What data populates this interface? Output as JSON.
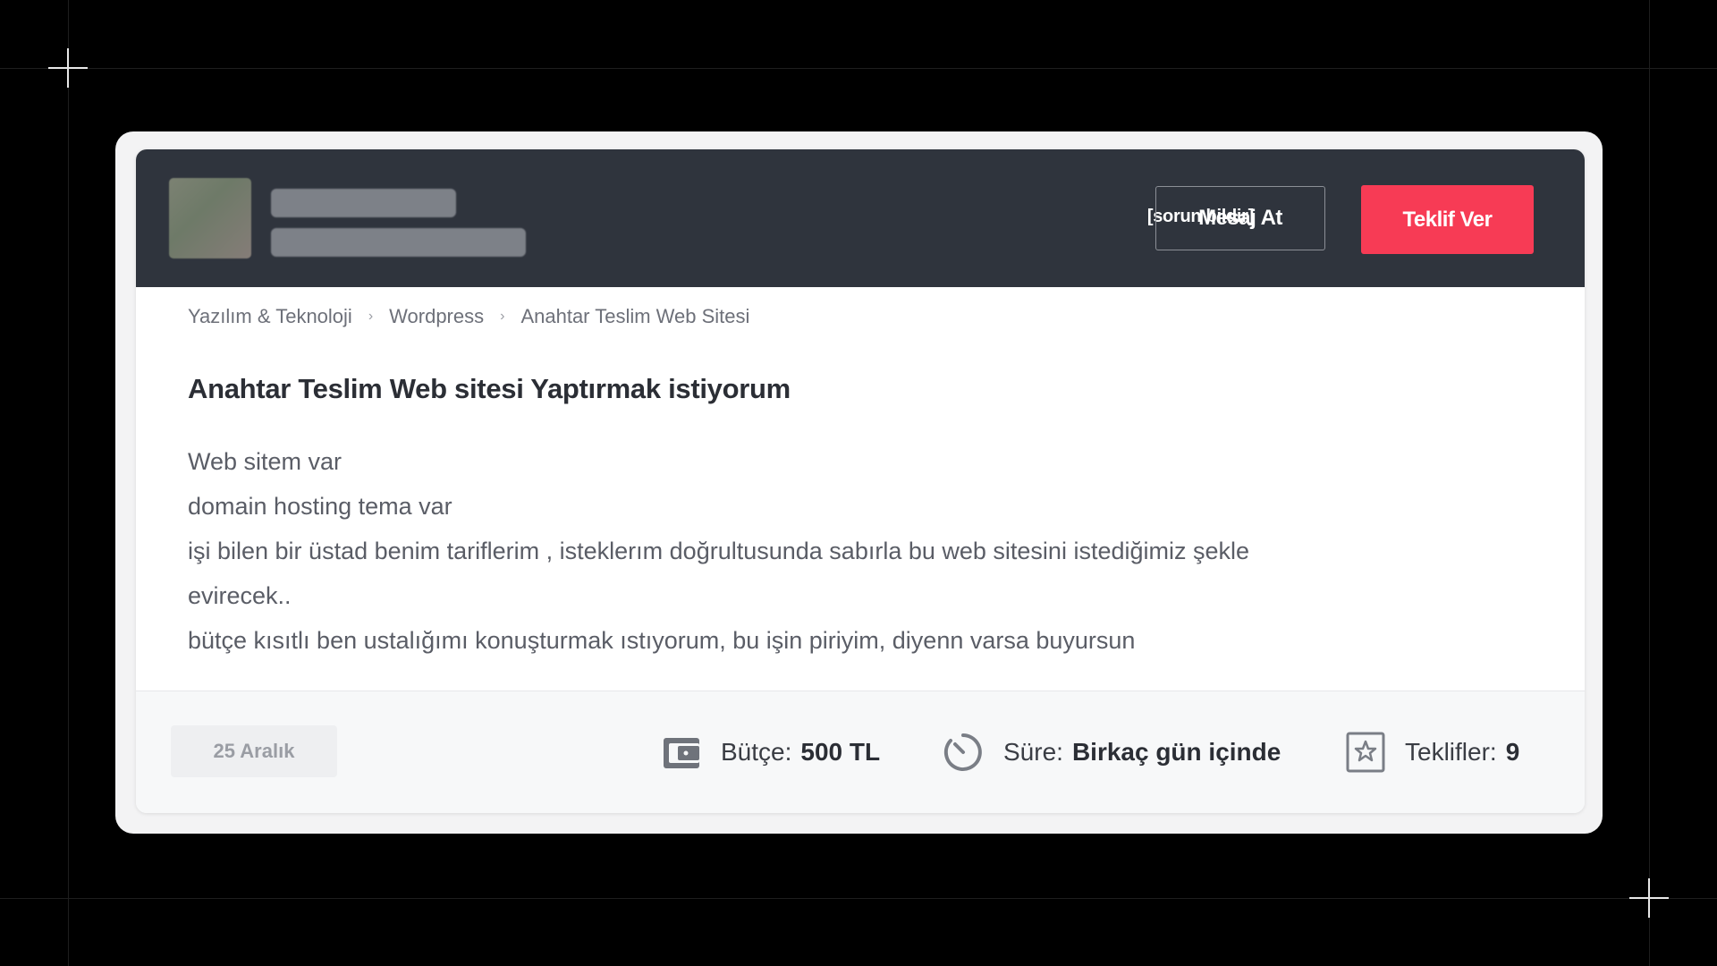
{
  "header": {
    "report_label": "[sorun bildir]",
    "message_button": "Mesaj At",
    "offer_button": "Teklif Ver",
    "accent_color": "#f73b55",
    "header_bg": "#2f343d"
  },
  "breadcrumb": {
    "items": [
      {
        "label": "Yazılım & Teknoloji"
      },
      {
        "label": "Wordpress"
      },
      {
        "label": "Anahtar Teslim Web Sitesi"
      }
    ]
  },
  "main": {
    "title": "Anahtar Teslim Web sitesi Yaptırmak istiyorum",
    "description_lines": [
      "Web sitem var",
      "domain hosting tema var",
      "işi bilen bir üstad benim tariflerim , isteklerım doğrultusunda sabırla bu web sitesini istediğimiz şekle",
      "evirecek..",
      "bütçe kısıtlı ben ustalığımı konuşturmak ıstıyorum, bu işin piriyim, diyenn varsa buyursun"
    ]
  },
  "footer": {
    "date": "25 Aralık",
    "budget_label": "Bütçe:",
    "budget_value": "500 TL",
    "budget_icon": "wallet-icon",
    "duration_label": "Süre:",
    "duration_value": "Birkaç gün içinde",
    "duration_icon": "timer-icon",
    "offers_label": "Teklifler:",
    "offers_value": "9",
    "offers_icon": "star-icon"
  }
}
